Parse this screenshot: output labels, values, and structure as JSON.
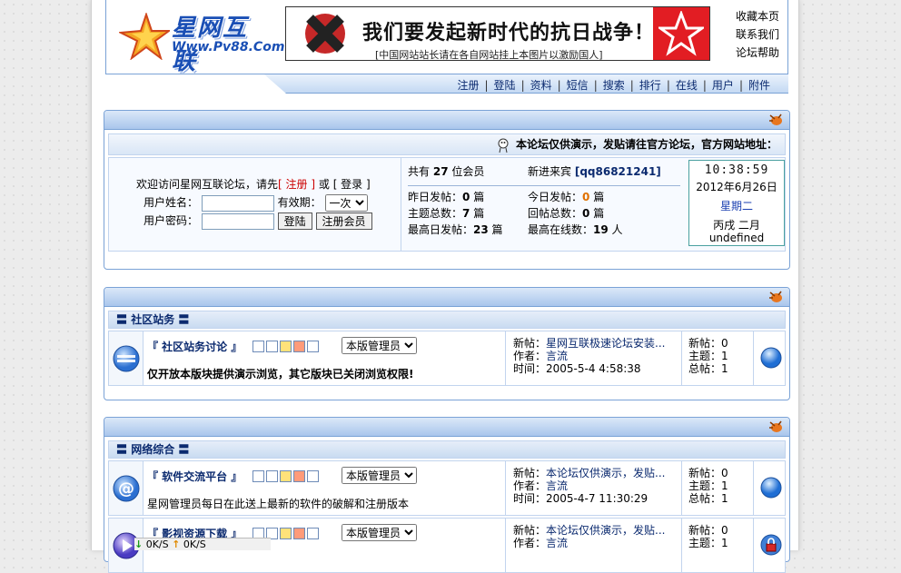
{
  "header": {
    "logo_text": "星网互联",
    "logo_url": "Www.Pv88.Com",
    "banner": {
      "slogan": "我们要发起新时代的抗日战争！！",
      "sub": "[中国网站站长请在各自网站挂上本图片以激励国人]"
    },
    "toplinks": [
      "收藏本页",
      "联系我们",
      "论坛帮助"
    ]
  },
  "nav": [
    "注册",
    "登陆",
    "资料",
    "短信",
    "搜索",
    "排行",
    "在线",
    "用户",
    "附件"
  ],
  "notice": "本论坛仅供演示，发贴请往官方论坛，官方网站地址：",
  "login": {
    "welcome_pre": "欢迎访问星网互联论坛，请先",
    "register_link": "[ 注册 ]",
    "or": "或",
    "login_link": "[ 登录 ]",
    "username_label": "用户姓名：",
    "validity_label": "有效期：",
    "validity_value": "一次",
    "password_label": "用户密码：",
    "login_button": "登陆",
    "register_button": "注册会员"
  },
  "stats": {
    "members_pre": "共有",
    "members": "27",
    "members_post": "位会员",
    "newest_label": "新进来宾",
    "newest": "[qq86821241]",
    "yesterday_label": "昨日发帖：",
    "yesterday": "0",
    "today_label": "今日发帖：",
    "today": "0",
    "topics_label": "主题总数：",
    "topics": "7",
    "replies_label": "回帖总数：",
    "replies": "0",
    "maxday_label": "最高日发帖：",
    "maxday": "23",
    "maxonline_label": "最高在线数：",
    "maxonline": "19",
    "unit_post": "篇",
    "unit_person": "人"
  },
  "clock": {
    "time": "10:38:59",
    "date": "2012年6月26日",
    "weekday": "星期二",
    "lunar": "丙戌 二月undefined"
  },
  "sections": [
    {
      "title": "社区站务",
      "forums": [
        {
          "name": "『 社区站务讨论 』",
          "moderator": "本版管理员",
          "desc": "仅开放本版块提供演示浏览，其它版块已关闭浏览权限!",
          "last_new_label": "新帖：",
          "last_new": "星网互联极速论坛安装...",
          "author_label": "作者：",
          "author": "言流",
          "time_label": "时间：",
          "time": "2005-5-4 4:58:38",
          "new_label": "新帖：",
          "new_count": "0",
          "topic_label": "主题：",
          "topic_count": "1",
          "total_label": "总帖：",
          "total_count": "1"
        }
      ]
    },
    {
      "title": "网络综合",
      "forums": [
        {
          "name": "『 软件交流平台 』",
          "moderator": "本版管理员",
          "desc": "星网管理员每日在此送上最新的软件的破解和注册版本",
          "last_new_label": "新帖：",
          "last_new": "本论坛仅供演示，发贴...",
          "author_label": "作者：",
          "author": "言流",
          "time_label": "时间：",
          "time": "2005-4-7 11:30:29",
          "new_label": "新帖：",
          "new_count": "0",
          "topic_label": "主题：",
          "topic_count": "1",
          "total_label": "总帖：",
          "total_count": "1"
        },
        {
          "name": "『 影视资源下载 』",
          "moderator": "本版管理员",
          "desc": "",
          "last_new_label": "新帖：",
          "last_new": "本论坛仅供演示，发贴...",
          "author_label": "作者：",
          "author": "言流",
          "time_label": "",
          "time": "",
          "new_label": "新帖：",
          "new_count": "0",
          "topic_label": "主题：",
          "topic_count": "1",
          "total_label": "",
          "total_count": ""
        }
      ]
    }
  ],
  "taskbar": {
    "down": "0K/S",
    "up": "0K/S"
  },
  "colors": {
    "link": "#0b2a6f",
    "accent_border": "#7aa2d6",
    "highlight": "#e07000"
  }
}
